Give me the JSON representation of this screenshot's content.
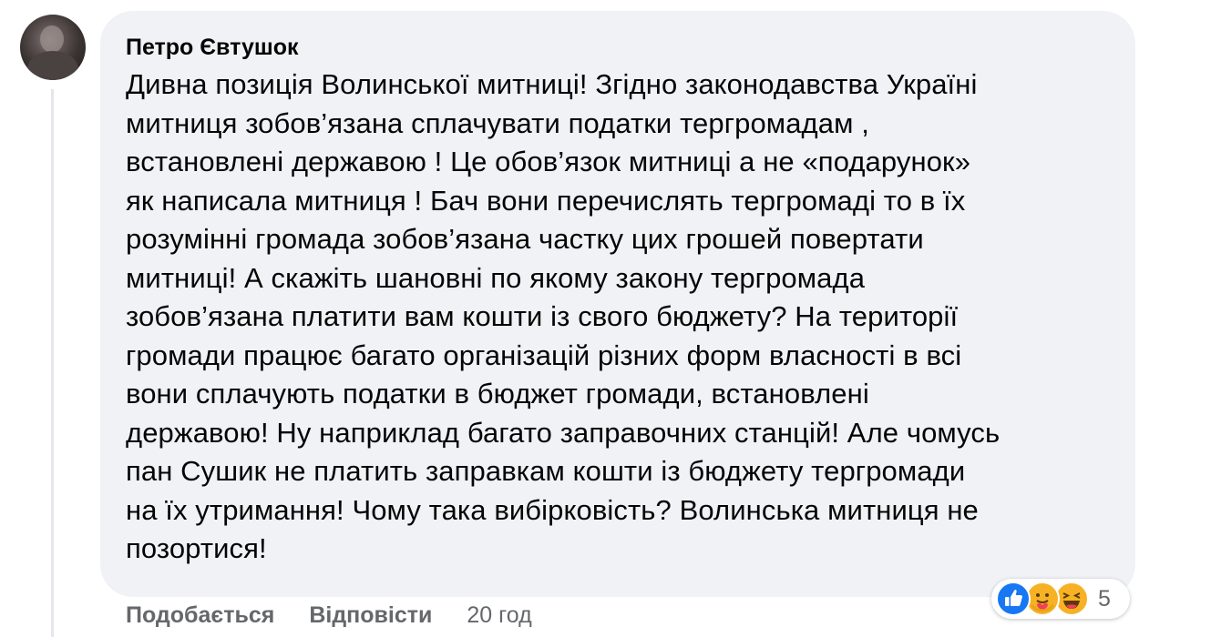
{
  "comment": {
    "author": "Петро Євтушок",
    "lines": [
      "Дивна позиція Волинської митниці! Згідно законодавства Україні",
      "митниця зобов’язана сплачувати податки тергромадам ,",
      "встановлені державою ! Це обов’язок митниці а не «подарунок»",
      "як написала митниця ! Бач вони перечислять тергромаді то в їх",
      "розумінні громада зобов’язана частку цих грошей повертати",
      "митниці! А скажіть шановні по якому закону тергромада",
      "зобов’язана платити вам кошти із свого бюджету? На території",
      "громади працює багато організацій різних форм власності в всі",
      "вони сплачують податки в бюджет громади, встановлені",
      "державою! Ну наприклад багато заправочних станцій! Але чомусь",
      "пан Сушик не платить заправкам кошти із бюджету тергромади",
      "на їх утримання! Чому така вибірковість? Волинська митниця не",
      "позортися!"
    ]
  },
  "actions": {
    "like_label": "Подобається",
    "reply_label": "Відповісти",
    "time": "20 год"
  },
  "reactions": {
    "icons": [
      "like-icon",
      "care-icon",
      "haha-icon"
    ],
    "count": "5"
  },
  "colors": {
    "bubble": "#f0f2f5",
    "text": "#050505",
    "secondary": "#65676b",
    "like_blue": "#1877f2",
    "emoji_yellow": "#f7b125"
  }
}
